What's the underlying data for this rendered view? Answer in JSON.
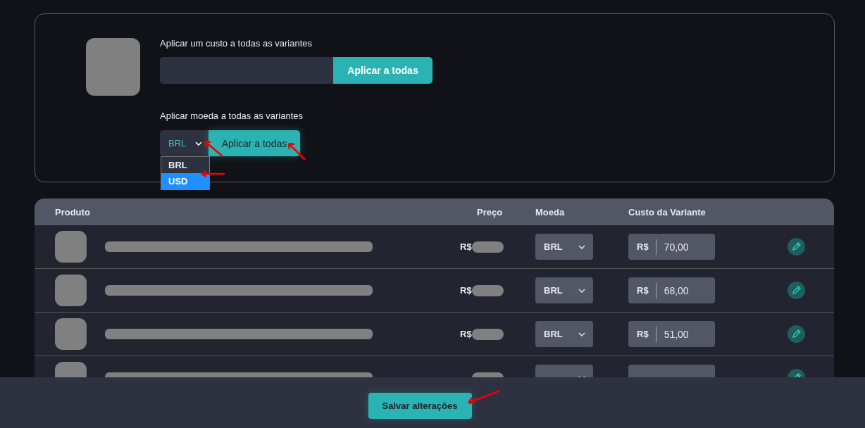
{
  "bulk_cost": {
    "label": "Aplicar um custo a todas as variantes",
    "button": "Aplicar a todas"
  },
  "bulk_currency": {
    "label": "Aplicar moeda a todas as variantes",
    "value": "BRL",
    "expanded": true,
    "options": [
      {
        "label": "BRL",
        "highlighted": false
      },
      {
        "label": "USD",
        "highlighted": true
      }
    ],
    "button": "Aplicar a todas"
  },
  "table": {
    "columns": [
      "Produto",
      "Preço",
      "Moeda",
      "Custo da Variante"
    ],
    "rows": [
      {
        "price_prefix": "R$",
        "currency": "BRL",
        "cost_prefix": "R$",
        "cost": "70,00"
      },
      {
        "price_prefix": "R$",
        "currency": "BRL",
        "cost_prefix": "R$",
        "cost": "68,00"
      },
      {
        "price_prefix": "R$",
        "currency": "BRL",
        "cost_prefix": "R$",
        "cost": "51,00"
      },
      {
        "partial": true
      }
    ]
  },
  "save_button": "Salvar alterações"
}
